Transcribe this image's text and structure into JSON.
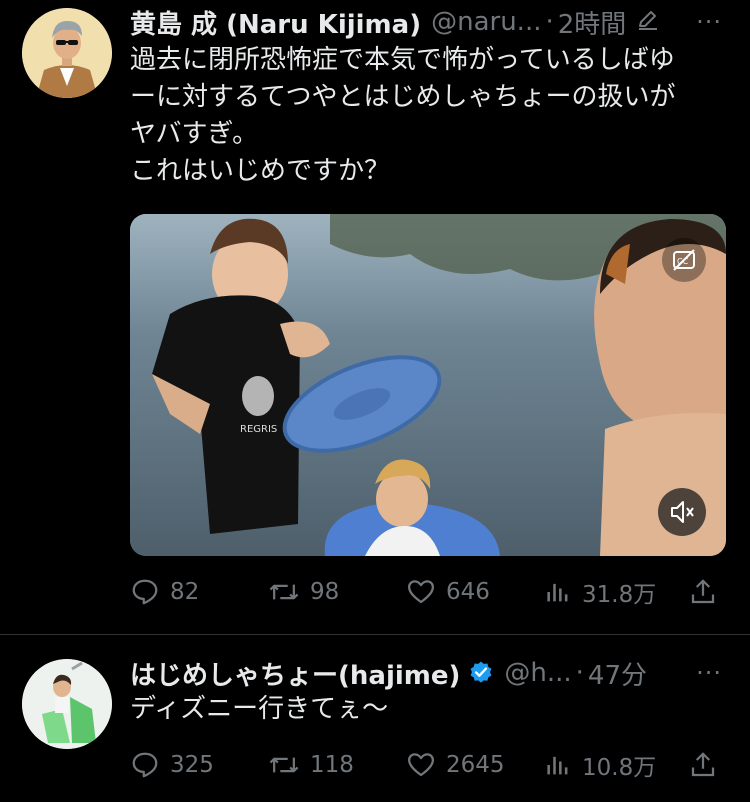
{
  "tweets": [
    {
      "author": {
        "name": "黄島 成 (Naru Kijima)",
        "handle": "@naru...",
        "time": "2時間"
      },
      "separator": "·",
      "more": "···",
      "body_lines": [
        "過去に閉所恐怖症で本気で怖がっているしばゆ",
        "ーに対するてつやとはじめしゃちょーの扱いが",
        "ヤバすぎ。",
        "これはいじめですか？"
      ],
      "media": {
        "kind": "video",
        "icons": [
          "closed-captions-off-icon",
          "volume-muted-icon"
        ],
        "shirt_print": "REGRIS"
      },
      "stats": {
        "replies": "82",
        "retweets": "98",
        "likes": "646",
        "views": "31.8万"
      }
    },
    {
      "author": {
        "name": "はじめしゃちょー(hajime)",
        "handle": "@h...",
        "time": "47分",
        "verified": true
      },
      "separator": "·",
      "more": "···",
      "body_lines": [
        "ディズニー行きてぇ〜"
      ],
      "stats": {
        "replies": "325",
        "retweets": "118",
        "likes": "2645",
        "views": "10.8万"
      }
    }
  ],
  "colors": {
    "background": "#000000",
    "text": "#e7e9ea",
    "muted": "#71767b",
    "divider": "#2f3336",
    "verified": "#1d9bf0"
  }
}
